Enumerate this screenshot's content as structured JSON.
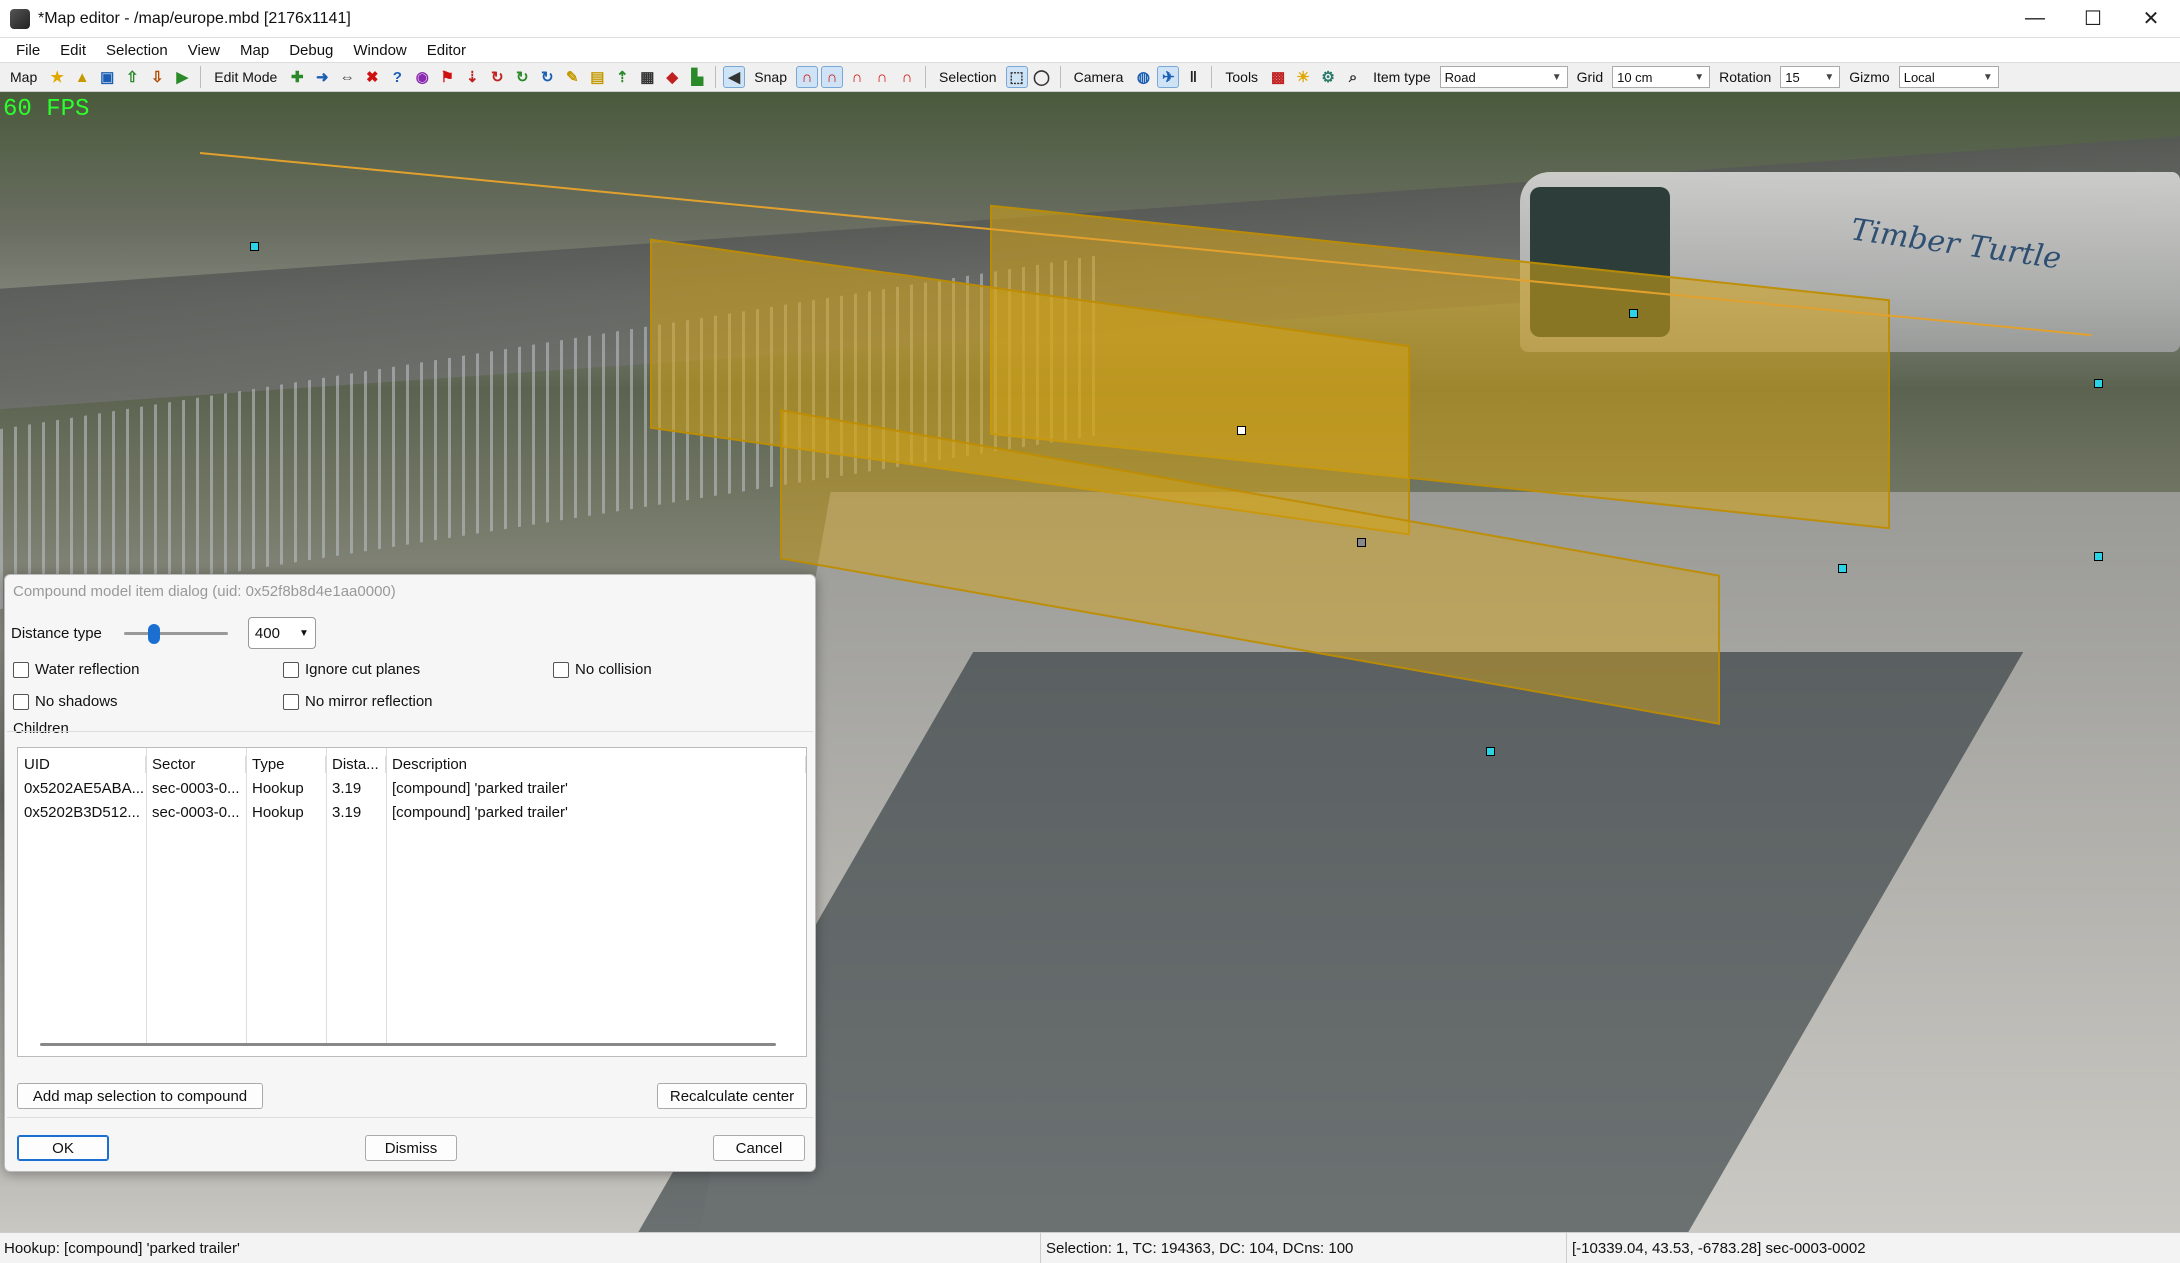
{
  "window": {
    "title": "*Map editor - /map/europe.mbd [2176x1141]",
    "minimize_glyph": "—",
    "maximize_glyph": "☐",
    "close_glyph": "✕"
  },
  "menu": [
    "File",
    "Edit",
    "Selection",
    "View",
    "Map",
    "Debug",
    "Window",
    "Editor"
  ],
  "toolbar": {
    "map_label": "Map",
    "edit_mode_label": "Edit Mode",
    "snap_label": "Snap",
    "selection_label": "Selection",
    "camera_label": "Camera",
    "tools_label": "Tools",
    "item_type_label": "Item type",
    "item_type_value": "Road",
    "grid_label": "Grid",
    "grid_value": "10 cm",
    "rotation_label": "Rotation",
    "rotation_value": "15",
    "gizmo_label": "Gizmo",
    "gizmo_value": "Local"
  },
  "viewport": {
    "fps": "60 FPS",
    "brand_text": "Timber Turtle"
  },
  "dialog": {
    "title": "Compound model item dialog (uid: 0x52f8b8d4e1aa0000)",
    "distance_type_label": "Distance type",
    "distance_value": "400",
    "checkboxes": {
      "water_reflection": "Water reflection",
      "ignore_cut_planes": "Ignore cut planes",
      "no_collision": "No collision",
      "no_shadows": "No shadows",
      "no_mirror_reflection": "No mirror reflection"
    },
    "children_label": "Children",
    "columns": [
      "UID",
      "Sector",
      "Type",
      "Dista...",
      "Description"
    ],
    "rows": [
      [
        "0x5202AE5ABA...",
        "sec-0003-0...",
        "Hookup",
        "3.19",
        "[compound] 'parked trailer'"
      ],
      [
        "0x5202B3D512...",
        "sec-0003-0...",
        "Hookup",
        "3.19",
        "[compound] 'parked trailer'"
      ]
    ],
    "add_selection_button": "Add map selection to compound",
    "recalculate_button": "Recalculate center",
    "ok_button": "OK",
    "dismiss_button": "Dismiss",
    "cancel_button": "Cancel"
  },
  "status": {
    "left": "Hookup: [compound] 'parked trailer'",
    "middle": "Selection: 1, TC: 194363, DC: 104, DCns: 100",
    "right": "[-10339.04, 43.53, -6783.28] sec-0003-0002"
  }
}
